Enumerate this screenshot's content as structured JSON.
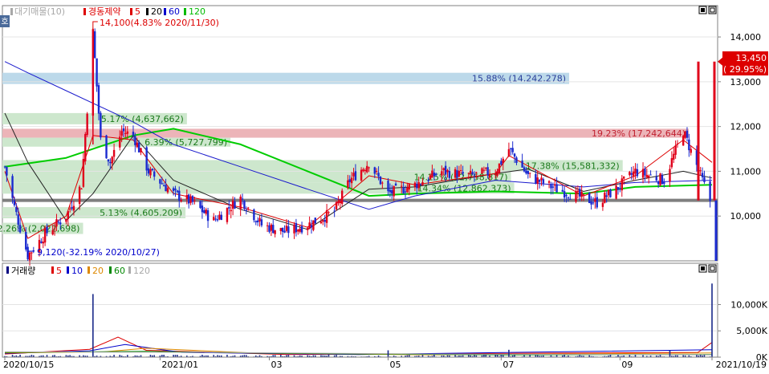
{
  "chart_data": {
    "type": "candlestick",
    "price_panel": {
      "legend": [
        {
          "label": "대기매물(10)",
          "color": "#a8a8a8"
        },
        {
          "label": "경동제약",
          "color": "#dd0000"
        },
        {
          "label": "5",
          "color": "#dd0000"
        },
        {
          "label": "20",
          "color": "#000000"
        },
        {
          "label": "60",
          "color": "#0000cc"
        },
        {
          "label": "120",
          "color": "#00bb00"
        }
      ],
      "y_ticks": [
        10000,
        11000,
        12000,
        13000,
        14000
      ],
      "y_tick_labels": [
        "10,000",
        "11,000",
        "12,000",
        "13,000",
        "14,000"
      ],
      "ylim": [
        9000,
        14700
      ],
      "high_annotation": "14,100(4.83% 2020/11/30)",
      "low_annotation": "9,120(-32.19% 2020/10/27)",
      "current_price": "13,450",
      "current_change": "( 29.95%)",
      "current_value": 13450,
      "reference_line": 10350,
      "volume_profile": [
        {
          "label": "15.88% (14,242,278)",
          "low": 12950,
          "high": 13200,
          "highlight": "blue"
        },
        {
          "label": "19.23% (17,242,644)",
          "low": 11750,
          "high": 11950,
          "highlight": "red"
        },
        {
          "label": "5.17% (4,637,662)",
          "low": 12050,
          "high": 12300
        },
        {
          "label": "6.39% (5,727,799)",
          "low": 11550,
          "high": 11750
        },
        {
          "label": "17.38% (15,581,332)",
          "low": 11000,
          "high": 11250
        },
        {
          "label": "14.25% (12,758,817)",
          "low": 10750,
          "high": 11000
        },
        {
          "label": "14.34% (12,862,373)",
          "low": 10500,
          "high": 10750
        },
        {
          "label": "5.13% (4,605,209)",
          "low": 9950,
          "high": 10200
        },
        {
          "label": "2.26% (2,022,698)",
          "low": 9600,
          "high": 9850
        }
      ]
    },
    "volume_panel": {
      "legend": [
        {
          "label": "거래량",
          "color": "#000080"
        },
        {
          "label": "5",
          "color": "#dd0000"
        },
        {
          "label": "10",
          "color": "#0000cc"
        },
        {
          "label": "20",
          "color": "#dd8800"
        },
        {
          "label": "60",
          "color": "#008800"
        },
        {
          "label": "120",
          "color": "#a8a8a8"
        }
      ],
      "y_ticks": [
        0,
        5000,
        10000
      ],
      "y_tick_labels": [
        "0K",
        "5,000K",
        "10,000K"
      ],
      "ylim": [
        0,
        14500
      ],
      "spikes": [
        {
          "date": "2020-11-30",
          "value": 12000
        },
        {
          "date": "2021-05-03",
          "value": 1300
        },
        {
          "date": "2021-07-05",
          "value": 1400
        },
        {
          "date": "2021-09-27",
          "value": 1300
        },
        {
          "date": "2021-10-19",
          "value": 14000
        }
      ]
    },
    "x_axis": {
      "labels": [
        "2020/10/15",
        "2021/01",
        "03",
        "05",
        "07",
        "09",
        "2021/10/19"
      ],
      "label_dates": [
        "2020-10-15",
        "2021-01-04",
        "2021-03-02",
        "2021-05-03",
        "2021-07-01",
        "2021-09-01",
        "2021-10-19"
      ]
    },
    "price_path": [
      [
        "2020-10-15",
        11100
      ],
      [
        "2020-10-20",
        10200
      ],
      [
        "2020-10-27",
        9120
      ],
      [
        "2020-11-05",
        9600
      ],
      [
        "2020-11-16",
        10000
      ],
      [
        "2020-11-24",
        10700
      ],
      [
        "2020-11-30",
        14100
      ],
      [
        "2020-12-04",
        11700
      ],
      [
        "2020-12-09",
        11200
      ],
      [
        "2020-12-15",
        11900
      ],
      [
        "2020-12-21",
        11800
      ],
      [
        "2020-12-29",
        11000
      ],
      [
        "2021-01-11",
        10500
      ],
      [
        "2021-01-21",
        10300
      ],
      [
        "2021-02-01",
        9900
      ],
      [
        "2021-02-15",
        10400
      ],
      [
        "2021-02-26",
        9800
      ],
      [
        "2021-03-10",
        9650
      ],
      [
        "2021-03-22",
        9800
      ],
      [
        "2021-04-05",
        10100
      ],
      [
        "2021-04-13",
        10800
      ],
      [
        "2021-04-23",
        11200
      ],
      [
        "2021-05-03",
        10500
      ],
      [
        "2021-05-17",
        10700
      ],
      [
        "2021-05-31",
        11000
      ],
      [
        "2021-06-15",
        10900
      ],
      [
        "2021-06-28",
        11000
      ],
      [
        "2021-07-05",
        11500
      ],
      [
        "2021-07-15",
        10900
      ],
      [
        "2021-07-30",
        10600
      ],
      [
        "2021-08-13",
        10400
      ],
      [
        "2021-08-20",
        10300
      ],
      [
        "2021-08-30",
        10600
      ],
      [
        "2021-09-09",
        11000
      ],
      [
        "2021-09-24",
        10800
      ],
      [
        "2021-10-04",
        11900
      ],
      [
        "2021-10-13",
        10900
      ],
      [
        "2021-10-18",
        10350
      ],
      [
        "2021-10-19",
        13450
      ]
    ],
    "ma120_path": [
      [
        "2020-10-15",
        11100
      ],
      [
        "2020-11-16",
        11300
      ],
      [
        "2020-12-21",
        11800
      ],
      [
        "2021-01-11",
        11950
      ],
      [
        "2021-02-15",
        11600
      ],
      [
        "2021-03-22",
        11000
      ],
      [
        "2021-04-23",
        10450
      ],
      [
        "2021-05-17",
        10500
      ],
      [
        "2021-06-28",
        10550
      ],
      [
        "2021-08-13",
        10500
      ],
      [
        "2021-09-09",
        10650
      ],
      [
        "2021-10-19",
        10700
      ]
    ],
    "ma60_path": [
      [
        "2020-10-15",
        13450
      ],
      [
        "2020-10-27",
        13200
      ],
      [
        "2020-11-16",
        12800
      ],
      [
        "2020-12-21",
        12100
      ],
      [
        "2021-01-11",
        11600
      ],
      [
        "2021-02-15",
        11100
      ],
      [
        "2021-03-22",
        10600
      ],
      [
        "2021-04-23",
        10150
      ],
      [
        "2021-05-17",
        10450
      ],
      [
        "2021-06-28",
        10800
      ],
      [
        "2021-08-13",
        10650
      ],
      [
        "2021-09-09",
        10750
      ],
      [
        "2021-10-19",
        10800
      ]
    ],
    "ma20_path": [
      [
        "2020-10-15",
        12300
      ],
      [
        "2020-10-27",
        11200
      ],
      [
        "2020-11-16",
        9900
      ],
      [
        "2020-11-30",
        10500
      ],
      [
        "2020-12-21",
        11800
      ],
      [
        "2021-01-11",
        10800
      ],
      [
        "2021-02-15",
        10150
      ],
      [
        "2021-03-22",
        9700
      ],
      [
        "2021-04-23",
        10600
      ],
      [
        "2021-05-17",
        10650
      ],
      [
        "2021-06-28",
        10950
      ],
      [
        "2021-07-15",
        11050
      ],
      [
        "2021-08-13",
        10550
      ],
      [
        "2021-09-09",
        10800
      ],
      [
        "2021-10-04",
        11000
      ],
      [
        "2021-10-19",
        10850
      ]
    ],
    "ma5_path": [
      [
        "2020-10-15",
        11000
      ],
      [
        "2020-10-27",
        9500
      ],
      [
        "2020-11-16",
        10000
      ],
      [
        "2020-11-30",
        11800
      ],
      [
        "2020-12-21",
        11700
      ],
      [
        "2021-01-11",
        10500
      ],
      [
        "2021-02-15",
        10200
      ],
      [
        "2021-03-22",
        9750
      ],
      [
        "2021-04-23",
        10900
      ],
      [
        "2021-05-17",
        10700
      ],
      [
        "2021-06-28",
        10950
      ],
      [
        "2021-07-05",
        11350
      ],
      [
        "2021-08-13",
        10450
      ],
      [
        "2021-09-09",
        10900
      ],
      [
        "2021-10-04",
        11700
      ],
      [
        "2021-10-19",
        11200
      ]
    ]
  }
}
